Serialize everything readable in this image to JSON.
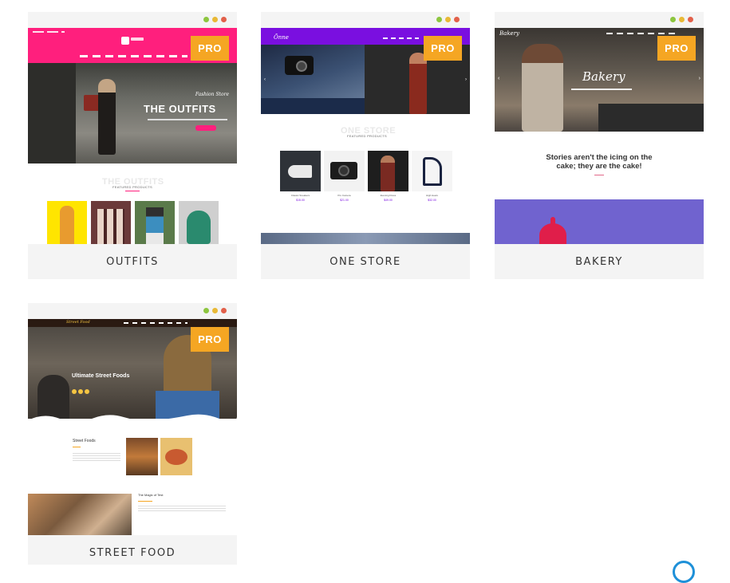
{
  "templates": [
    {
      "name": "OUTFITS",
      "pro_badge": "PRO",
      "hero_title": "THE OUTFITS",
      "hero_script": "Fashion Store",
      "section_title": "THE OUTFITS",
      "section_sub": "FEATURED PRODUCTS"
    },
    {
      "name": "ONE STORE",
      "pro_badge": "PRO",
      "section_title": "ONE STORE",
      "section_sub": "FEATURED PRODUCTS",
      "products": [
        {
          "name": "Classic Sneakers",
          "price": "$15.00"
        },
        {
          "name": "Pro Camera",
          "price": "$21.00"
        },
        {
          "name": "Evening Dress",
          "price": "$49.00"
        },
        {
          "name": "High Heels",
          "price": "$32.00"
        }
      ]
    },
    {
      "name": "BAKERY",
      "pro_badge": "PRO",
      "logo": "Bakery",
      "hero_script": "Bakery",
      "quote": "Stories aren't the icing on the cake; they are the cake!"
    },
    {
      "name": "STREET FOOD",
      "pro_badge": "PRO",
      "logo": "Street Food",
      "hero_title": "Ultimate Street Foods",
      "section1_title": "Street Foods",
      "section2_title": "The Magic of Test"
    }
  ],
  "colors": {
    "pro_badge": "#f5a623",
    "outfits_pink": "#ff1f7d",
    "onestore_purple": "#7a0fe0",
    "bakery_purple": "#7063cf",
    "window_green": "#8dc63f",
    "window_yellow": "#e9b936",
    "window_red": "#e2604a"
  }
}
